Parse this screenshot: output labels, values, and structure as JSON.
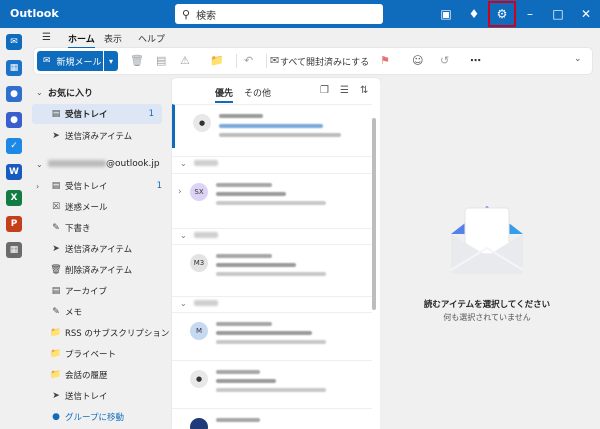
{
  "titlebar": {
    "app_title": "Outlook",
    "search_placeholder": "検索"
  },
  "ribbon": {
    "tabs": [
      "ホーム",
      "表示",
      "ヘルプ"
    ],
    "new_mail_label": "新規メール",
    "mark_all_read_label": "すべて開封済みにする"
  },
  "folders": {
    "favorites_header": "お気に入り",
    "favorites": [
      {
        "label": "受信トレイ",
        "count": "1"
      },
      {
        "label": "送信済みアイテム",
        "count": ""
      }
    ],
    "account_suffix": "@outlook.jp",
    "account_folders": [
      {
        "label": "受信トレイ",
        "count": "1"
      },
      {
        "label": "迷惑メール",
        "count": ""
      },
      {
        "label": "下書き",
        "count": ""
      },
      {
        "label": "送信済みアイテム",
        "count": ""
      },
      {
        "label": "削除済みアイテム",
        "count": ""
      },
      {
        "label": "アーカイブ",
        "count": ""
      },
      {
        "label": "メモ",
        "count": ""
      },
      {
        "label": "RSS のサブスクリプション",
        "count": ""
      },
      {
        "label": "プライベート",
        "count": ""
      },
      {
        "label": "会話の履歴",
        "count": ""
      },
      {
        "label": "送信トレイ",
        "count": ""
      }
    ],
    "go_to_groups": "グループに移動"
  },
  "message_list": {
    "tabs": [
      "優先",
      "その他"
    ],
    "avatars": [
      "SX",
      "M3",
      "M"
    ]
  },
  "reading_pane": {
    "empty_title": "読むアイテムを選択してください",
    "empty_subtitle": "何も選択されていません"
  },
  "colors": {
    "brand": "#0f6cbd",
    "highlight": "#d0021b"
  }
}
